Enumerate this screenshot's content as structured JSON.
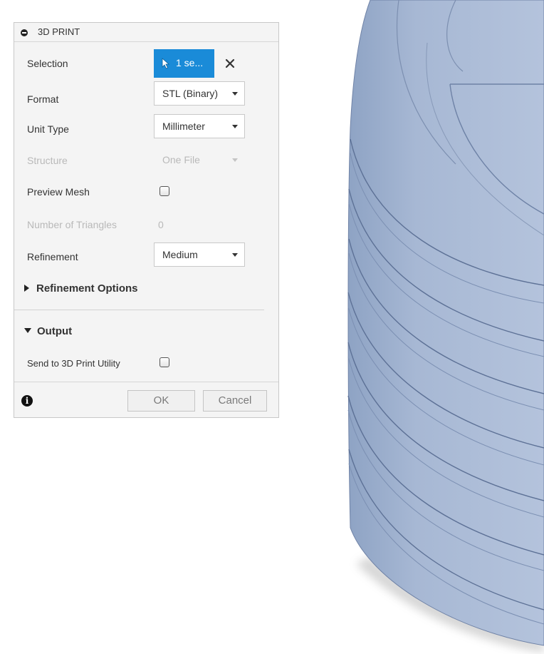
{
  "dialog": {
    "title": "3D PRINT",
    "selection": {
      "label": "Selection",
      "button_text": "1 se..."
    },
    "format": {
      "label": "Format",
      "value": "STL (Binary)"
    },
    "unit_type": {
      "label": "Unit Type",
      "value": "Millimeter"
    },
    "structure": {
      "label": "Structure",
      "value": "One File"
    },
    "preview_mesh": {
      "label": "Preview Mesh",
      "checked": false
    },
    "triangles": {
      "label": "Number of Triangles",
      "value": "0"
    },
    "refinement": {
      "label": "Refinement",
      "value": "Medium"
    },
    "refinement_options": {
      "label": "Refinement Options",
      "expanded": false
    },
    "output": {
      "label": "Output",
      "expanded": true
    },
    "send_to_utility": {
      "label": "Send to 3D Print Utility",
      "checked": false
    },
    "buttons": {
      "ok": "OK",
      "cancel": "Cancel"
    }
  },
  "colors": {
    "accent": "#1a8bd8",
    "model_fill": "#a9bbd8",
    "model_edge": "#5d7196"
  },
  "icons": {
    "collapse": "minus-circle-icon",
    "cursor": "cursor-arrow-icon",
    "clear": "close-icon",
    "info": "info-icon"
  }
}
